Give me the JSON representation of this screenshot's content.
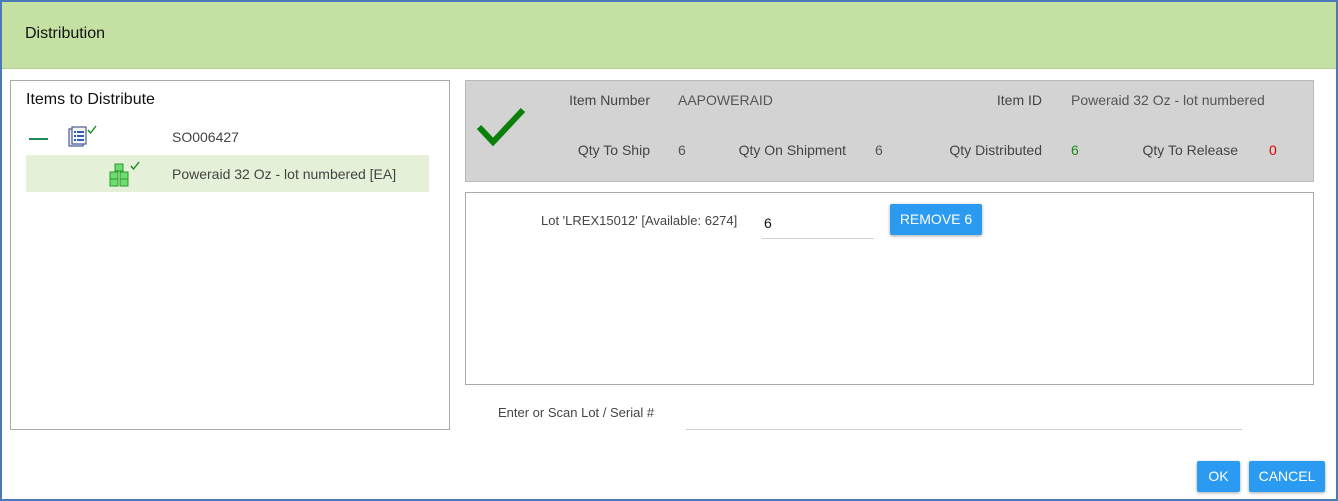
{
  "dialog": {
    "title": "Distribution"
  },
  "left_panel": {
    "heading": "Items to Distribute",
    "order": {
      "label": "SO006427",
      "icon": "document-list-icon",
      "status": "check"
    },
    "items": [
      {
        "label": "Poweraid 32 Oz - lot numbered [EA]",
        "icon": "lot-boxes-icon",
        "status": "check",
        "selected": true
      }
    ]
  },
  "summary": {
    "status_icon": "checkmark-icon",
    "item_number_label": "Item Number",
    "item_number": "AAPOWERAID",
    "item_id_label": "Item ID",
    "item_id": "Poweraid 32 Oz - lot numbered",
    "qty_to_ship_label": "Qty To Ship",
    "qty_to_ship": "6",
    "qty_on_shipment_label": "Qty On Shipment",
    "qty_on_shipment": "6",
    "qty_distributed_label": "Qty Distributed",
    "qty_distributed": "6",
    "qty_to_release_label": "Qty To Release",
    "qty_to_release": "0"
  },
  "lots": [
    {
      "label": "Lot 'LREX15012' [Available: 6274]",
      "quantity": "6",
      "remove_label": "REMOVE 6"
    }
  ],
  "scan": {
    "label": "Enter or Scan Lot / Serial #",
    "value": ""
  },
  "footer": {
    "ok_label": "OK",
    "cancel_label": "CANCEL"
  },
  "colors": {
    "titlebar": "#c5e0a3",
    "accent_button": "#2a9bf0",
    "distributed_green": "#1a8a1a",
    "release_red": "#e00000",
    "check_green": "#008000",
    "selected_row": "#e4f0d7"
  }
}
